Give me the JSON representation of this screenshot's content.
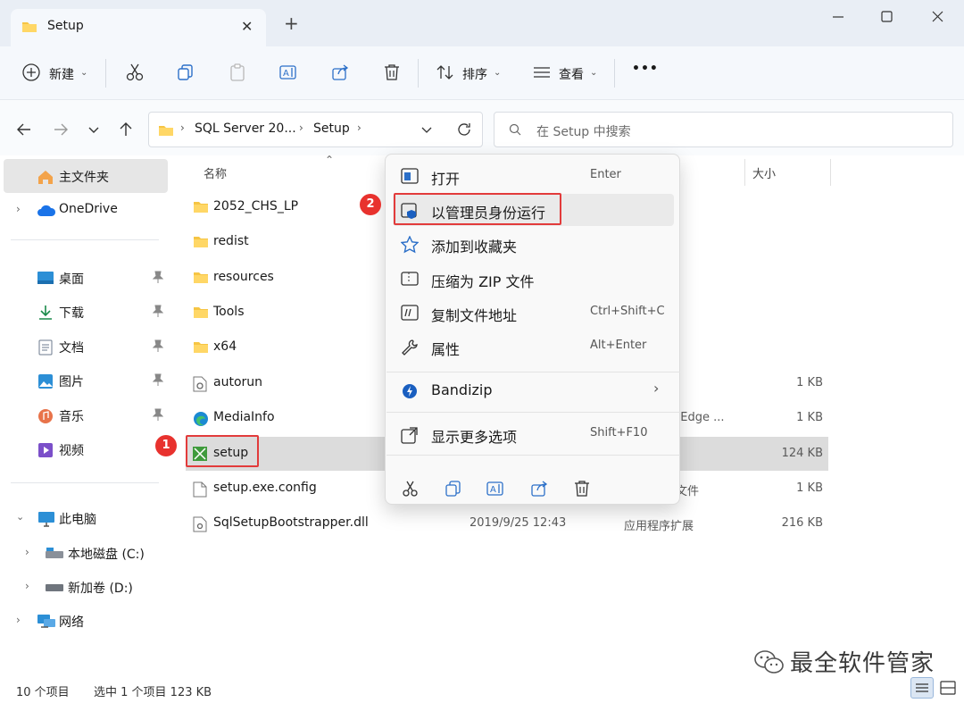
{
  "window": {
    "tab_title": "Setup",
    "new_tab": "+"
  },
  "toolbar": {
    "new_label": "新建",
    "sort_label": "排序",
    "view_label": "查看",
    "more": "•••"
  },
  "address": {
    "breadcrumbs": [
      "SQL Server 20...",
      "Setup"
    ],
    "search_placeholder": "在 Setup 中搜索"
  },
  "nav": {
    "home": "主文件夹",
    "onedrive": "OneDrive",
    "quick": [
      "桌面",
      "下载",
      "文档",
      "图片",
      "音乐",
      "视频"
    ],
    "this_pc": "此电脑",
    "drives": [
      "本地磁盘 (C:)",
      "新加卷 (D:)"
    ],
    "network": "网络"
  },
  "columns": {
    "name": "名称",
    "size": "大小"
  },
  "files": [
    {
      "name": "2052_CHS_LP",
      "date": "",
      "type": "",
      "size": ""
    },
    {
      "name": "redist",
      "date": "",
      "type": "",
      "size": ""
    },
    {
      "name": "resources",
      "date": "",
      "type": "",
      "size": ""
    },
    {
      "name": "Tools",
      "date": "",
      "type": "",
      "size": ""
    },
    {
      "name": "x64",
      "date": "",
      "type": "",
      "size": ""
    },
    {
      "name": "autorun",
      "date": "",
      "type": "",
      "size": "1 KB"
    },
    {
      "name": "MediaInfo",
      "date": "",
      "type": "t Edge ...",
      "size": "1 KB"
    },
    {
      "name": "setup",
      "date": "",
      "type": "",
      "size": "124 KB"
    },
    {
      "name": "setup.exe.config",
      "date": "",
      "type": "文件",
      "size": "1 KB"
    },
    {
      "name": "SqlSetupBootstrapper.dll",
      "date": "2019/9/25 12:43",
      "type": "应用程序扩展",
      "size": "216 KB"
    }
  ],
  "menu": {
    "open": "打开",
    "open_key": "Enter",
    "run_as_admin": "以管理员身份运行",
    "add_favorite": "添加到收藏夹",
    "compress_zip": "压缩为 ZIP 文件",
    "copy_path": "复制文件地址",
    "copy_path_key": "Ctrl+Shift+C",
    "properties": "属性",
    "properties_key": "Alt+Enter",
    "bandizip": "Bandizip",
    "more_options": "显示更多选项",
    "more_options_key": "Shift+F10"
  },
  "badges": {
    "one": "1",
    "two": "2"
  },
  "status": {
    "item_count": "10 个项目",
    "selection": "选中 1 个项目 123 KB"
  },
  "watermark": "最全软件管家",
  "colors": {
    "accent": "#0067c0",
    "annotation": "#e23b3b",
    "selection": "#dcdcdc"
  }
}
